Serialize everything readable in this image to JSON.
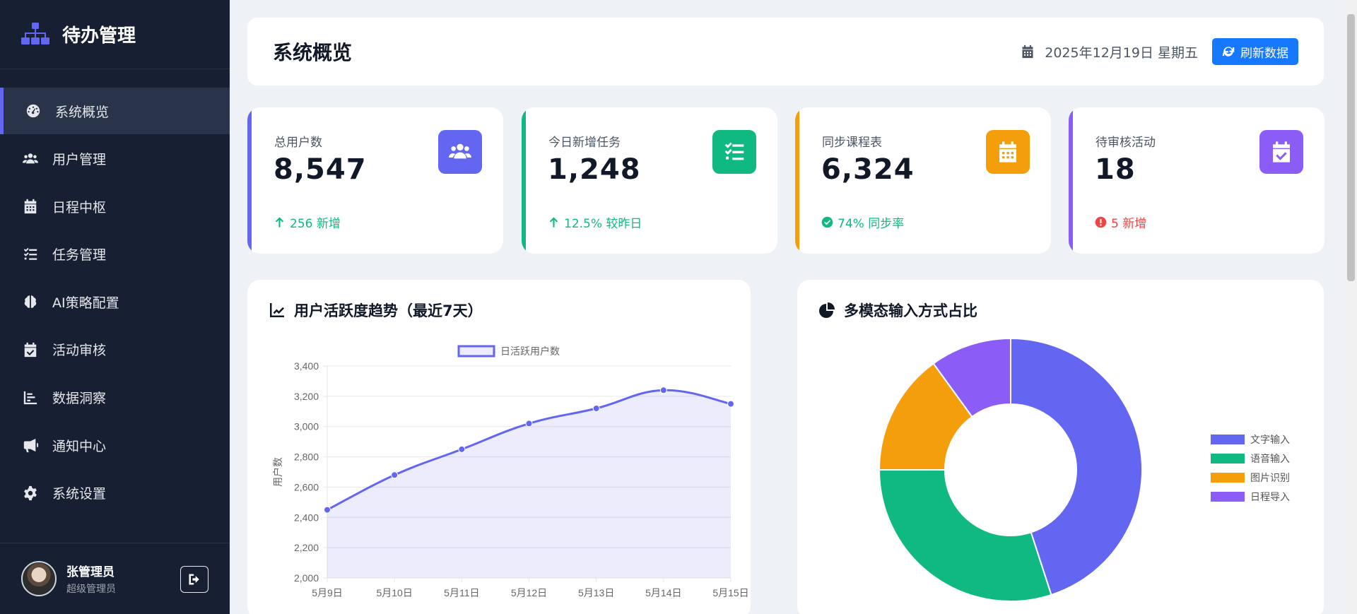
{
  "app": {
    "title": "待办管理"
  },
  "sidebar": {
    "items": [
      {
        "label": "系统概览",
        "icon": "dashboard-icon",
        "active": true
      },
      {
        "label": "用户管理",
        "icon": "users-icon"
      },
      {
        "label": "日程中枢",
        "icon": "calendar-icon"
      },
      {
        "label": "任务管理",
        "icon": "task-list-icon"
      },
      {
        "label": "AI策略配置",
        "icon": "brain-icon"
      },
      {
        "label": "活动审核",
        "icon": "calendar-check-icon"
      },
      {
        "label": "数据洞察",
        "icon": "bar-chart-icon"
      },
      {
        "label": "通知中心",
        "icon": "megaphone-icon"
      },
      {
        "label": "系统设置",
        "icon": "gear-icon"
      }
    ],
    "user": {
      "name": "张管理员",
      "role": "超级管理员"
    }
  },
  "header": {
    "title": "系统概览",
    "date": "2025年12月19日 星期五",
    "refresh_label": "刷新数据"
  },
  "stats": [
    {
      "label": "总用户数",
      "value": "8,547",
      "foot": "256 新增",
      "accent": "#6366f1",
      "icon_color": "#6366f1",
      "foot_color": "#10b981",
      "icon": "users-icon",
      "foot_icon": "arrow-up-icon"
    },
    {
      "label": "今日新增任务",
      "value": "1,248",
      "foot": "12.5% 较昨日",
      "accent": "#10b981",
      "icon_color": "#10b981",
      "foot_color": "#10b981",
      "icon": "task-list-icon",
      "foot_icon": "arrow-up-icon"
    },
    {
      "label": "同步课程表",
      "value": "6,324",
      "foot": "74% 同步率",
      "accent": "#f59e0b",
      "icon_color": "#f59e0b",
      "foot_color": "#10b981",
      "icon": "calendar-icon",
      "foot_icon": "check-circle-icon"
    },
    {
      "label": "待审核活动",
      "value": "18",
      "foot": "5 新增",
      "accent": "#8b5cf6",
      "icon_color": "#8b5cf6",
      "foot_color": "#ef4444",
      "icon": "calendar-check-icon",
      "foot_icon": "alert-circle-icon"
    }
  ],
  "line_panel": {
    "title": "用户活跃度趋势（最近7天）"
  },
  "pie_panel": {
    "title": "多模态输入方式占比"
  },
  "chart_data": [
    {
      "type": "line",
      "title": "用户活跃度趋势（最近7天）",
      "x": [
        "5月9日",
        "5月10日",
        "5月11日",
        "5月12日",
        "5月13日",
        "5月14日",
        "5月15日"
      ],
      "series": [
        {
          "name": "日活跃用户数",
          "values": [
            2450,
            2680,
            2850,
            3020,
            3120,
            3240,
            3150
          ],
          "color": "#6366f1"
        }
      ],
      "ylabel": "用户数",
      "ylim": [
        2000,
        3400
      ],
      "yticks": [
        "2,000",
        "2,200",
        "2,400",
        "2,600",
        "2,800",
        "3,000",
        "3,200",
        "3,400"
      ],
      "legend": "top",
      "grid": true,
      "area_fill": true
    },
    {
      "type": "pie",
      "donut": true,
      "title": "多模态输入方式占比",
      "categories": [
        "文字输入",
        "语音输入",
        "图片识别",
        "日程导入"
      ],
      "values": [
        45,
        30,
        15,
        10
      ],
      "colors": [
        "#6366f1",
        "#10b981",
        "#f59e0b",
        "#8b5cf6"
      ],
      "legend": "right"
    }
  ]
}
